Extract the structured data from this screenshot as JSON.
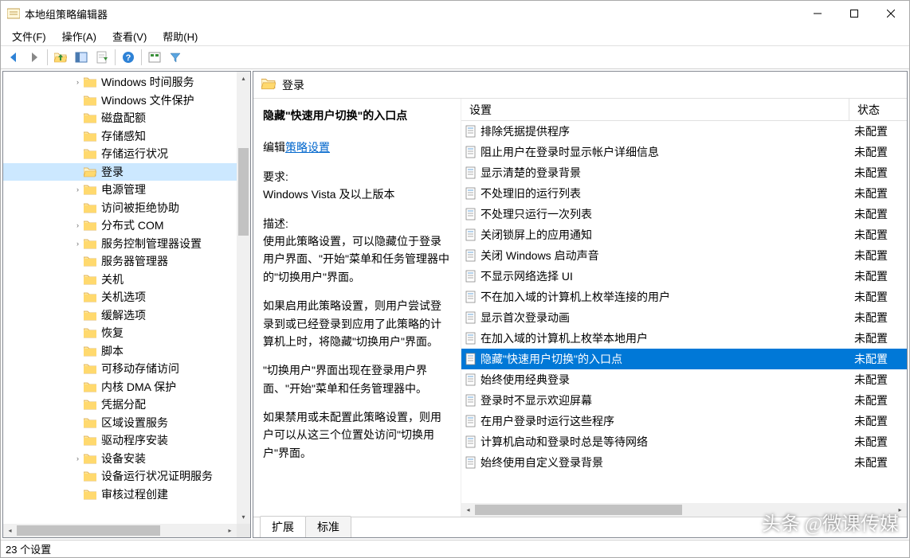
{
  "window": {
    "title": "本地组策略编辑器"
  },
  "menubar": {
    "items": [
      "文件(F)",
      "操作(A)",
      "查看(V)",
      "帮助(H)"
    ]
  },
  "tree": {
    "selected_index": 5,
    "items": [
      {
        "label": "Windows 时间服务",
        "exp": "›"
      },
      {
        "label": "Windows 文件保护",
        "exp": ""
      },
      {
        "label": "磁盘配额",
        "exp": ""
      },
      {
        "label": "存储感知",
        "exp": ""
      },
      {
        "label": "存储运行状况",
        "exp": ""
      },
      {
        "label": "登录",
        "exp": ""
      },
      {
        "label": "电源管理",
        "exp": "›"
      },
      {
        "label": "访问被拒绝协助",
        "exp": ""
      },
      {
        "label": "分布式 COM",
        "exp": "›"
      },
      {
        "label": "服务控制管理器设置",
        "exp": "›"
      },
      {
        "label": "服务器管理器",
        "exp": ""
      },
      {
        "label": "关机",
        "exp": ""
      },
      {
        "label": "关机选项",
        "exp": ""
      },
      {
        "label": "缓解选项",
        "exp": ""
      },
      {
        "label": "恢复",
        "exp": ""
      },
      {
        "label": "脚本",
        "exp": ""
      },
      {
        "label": "可移动存储访问",
        "exp": ""
      },
      {
        "label": "内核 DMA 保护",
        "exp": ""
      },
      {
        "label": "凭据分配",
        "exp": ""
      },
      {
        "label": "区域设置服务",
        "exp": ""
      },
      {
        "label": "驱动程序安装",
        "exp": ""
      },
      {
        "label": "设备安装",
        "exp": "›"
      },
      {
        "label": "设备运行状况证明服务",
        "exp": ""
      },
      {
        "label": "审核过程创建",
        "exp": ""
      }
    ]
  },
  "header": {
    "title": "登录"
  },
  "detail": {
    "title": "隐藏\"快速用户切换\"的入口点",
    "edit_label": "编辑",
    "link": "策略设置",
    "req_label": "要求:",
    "req_value": "Windows Vista 及以上版本",
    "desc_label": "描述:",
    "p1": "使用此策略设置，可以隐藏位于登录用户界面、\"开始\"菜单和任务管理器中的\"切换用户\"界面。",
    "p2": "如果启用此策略设置，则用户尝试登录到或已经登录到应用了此策略的计算机上时，将隐藏\"切换用户\"界面。",
    "p3": "\"切换用户\"界面出现在登录用户界面、\"开始\"菜单和任务管理器中。",
    "p4": "如果禁用或未配置此策略设置，则用户可以从这三个位置处访问\"切换用户\"界面。"
  },
  "list": {
    "col_setting": "设置",
    "col_status": "状态",
    "selected_index": 11,
    "rows": [
      {
        "label": "排除凭据提供程序",
        "status": "未配置"
      },
      {
        "label": "阻止用户在登录时显示帐户详细信息",
        "status": "未配置"
      },
      {
        "label": "显示清楚的登录背景",
        "status": "未配置"
      },
      {
        "label": "不处理旧的运行列表",
        "status": "未配置"
      },
      {
        "label": "不处理只运行一次列表",
        "status": "未配置"
      },
      {
        "label": "关闭锁屏上的应用通知",
        "status": "未配置"
      },
      {
        "label": "关闭 Windows 启动声音",
        "status": "未配置"
      },
      {
        "label": "不显示网络选择 UI",
        "status": "未配置"
      },
      {
        "label": "不在加入域的计算机上枚举连接的用户",
        "status": "未配置"
      },
      {
        "label": "显示首次登录动画",
        "status": "未配置"
      },
      {
        "label": "在加入域的计算机上枚举本地用户",
        "status": "未配置"
      },
      {
        "label": "隐藏\"快速用户切换\"的入口点",
        "status": "未配置"
      },
      {
        "label": "始终使用经典登录",
        "status": "未配置"
      },
      {
        "label": "登录时不显示欢迎屏幕",
        "status": "未配置"
      },
      {
        "label": "在用户登录时运行这些程序",
        "status": "未配置"
      },
      {
        "label": "计算机启动和登录时总是等待网络",
        "status": "未配置"
      },
      {
        "label": "始终使用自定义登录背景",
        "status": "未配置"
      }
    ]
  },
  "tabs": {
    "items": [
      "扩展",
      "标准"
    ],
    "active": 0
  },
  "statusbar": {
    "text": "23 个设置"
  },
  "watermark": "头条 @微课传媒"
}
